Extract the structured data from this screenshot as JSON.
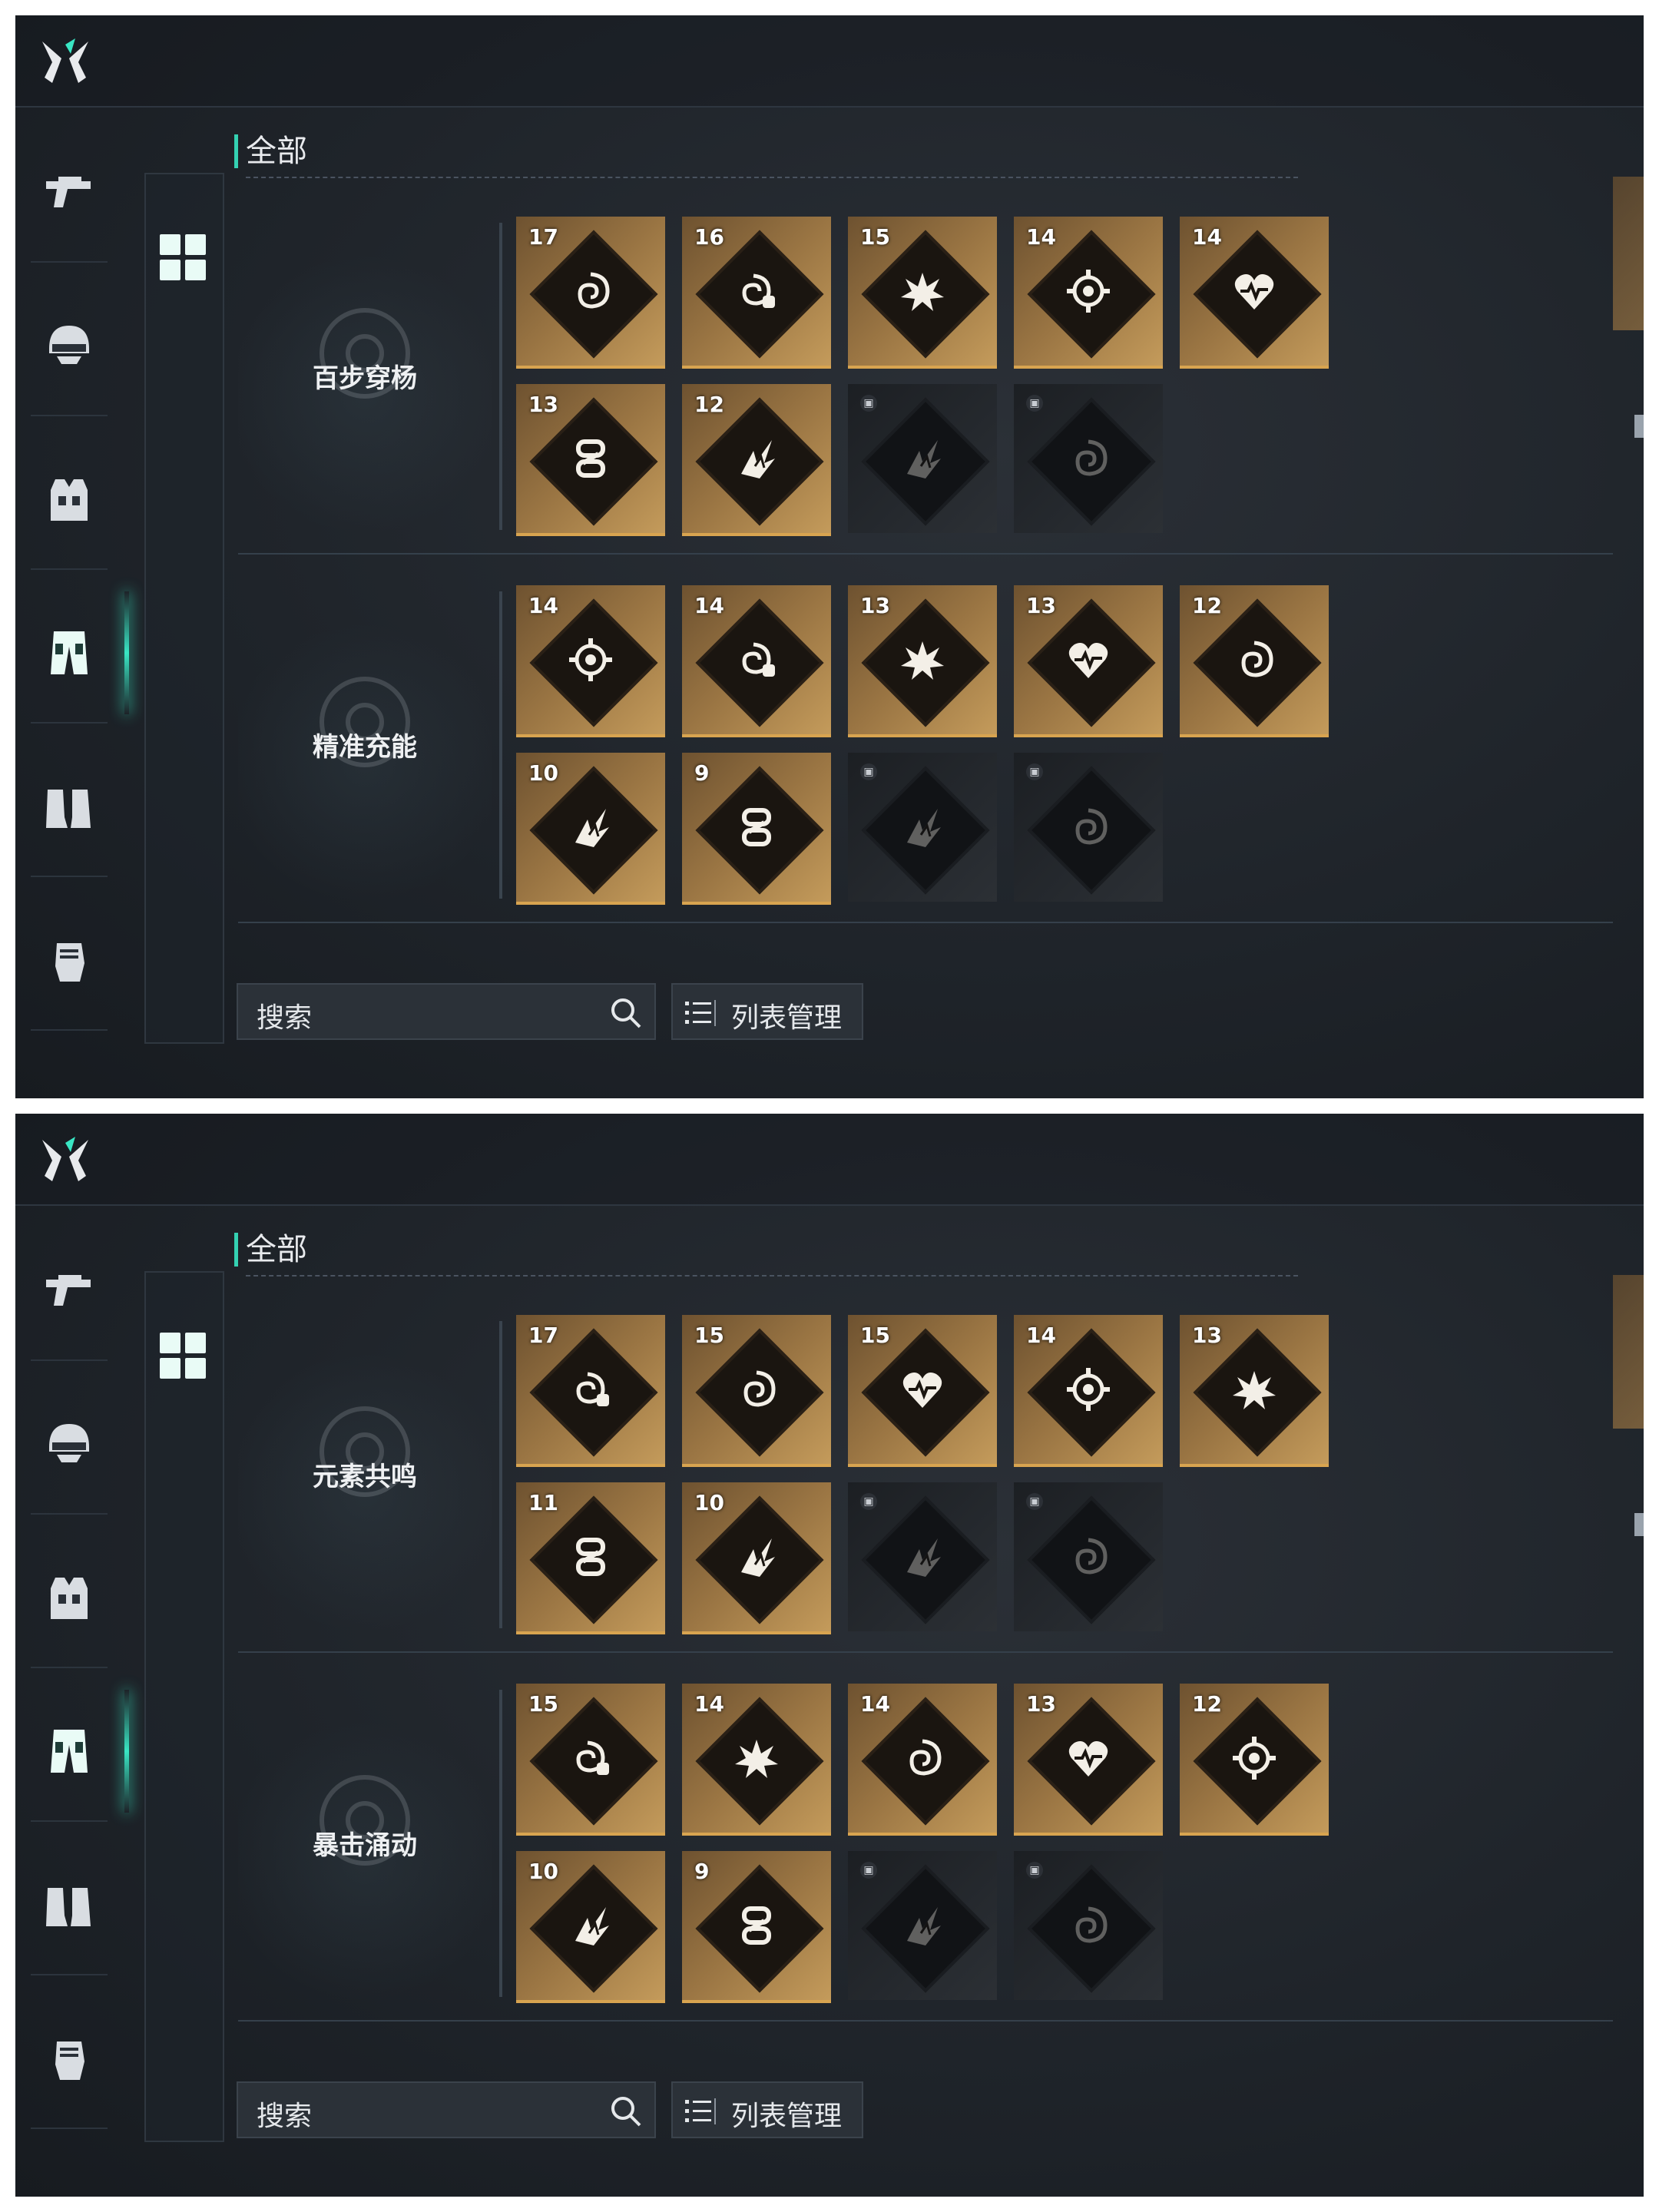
{
  "panels": [
    {
      "section_title": "全部",
      "search_placeholder": "搜索",
      "list_button": "列表管理",
      "rows": [
        {
          "label": "百步穿杨",
          "cards": [
            {
              "num": "17",
              "icon": "vortex"
            },
            {
              "num": "16",
              "icon": "vortex-link"
            },
            {
              "num": "15",
              "icon": "explosion"
            },
            {
              "num": "14",
              "icon": "crosshair"
            },
            {
              "num": "14",
              "icon": "heart-pulse"
            },
            {
              "num": "13",
              "icon": "chain"
            },
            {
              "num": "12",
              "icon": "arrow-burst"
            },
            {
              "num": "",
              "icon": "arrow-burst",
              "locked": true
            },
            {
              "num": "",
              "icon": "vortex",
              "locked": true
            }
          ]
        },
        {
          "label": "精准充能",
          "cards": [
            {
              "num": "14",
              "icon": "crosshair"
            },
            {
              "num": "14",
              "icon": "vortex-link"
            },
            {
              "num": "13",
              "icon": "explosion"
            },
            {
              "num": "13",
              "icon": "heart-pulse"
            },
            {
              "num": "12",
              "icon": "vortex"
            },
            {
              "num": "10",
              "icon": "arrow-burst"
            },
            {
              "num": "9",
              "icon": "chain"
            },
            {
              "num": "",
              "icon": "arrow-burst",
              "locked": true
            },
            {
              "num": "",
              "icon": "vortex",
              "locked": true
            }
          ]
        }
      ]
    },
    {
      "section_title": "全部",
      "search_placeholder": "搜索",
      "list_button": "列表管理",
      "rows": [
        {
          "label": "元素共鸣",
          "cards": [
            {
              "num": "17",
              "icon": "vortex-link"
            },
            {
              "num": "15",
              "icon": "vortex"
            },
            {
              "num": "15",
              "icon": "heart-pulse"
            },
            {
              "num": "14",
              "icon": "crosshair"
            },
            {
              "num": "13",
              "icon": "explosion"
            },
            {
              "num": "11",
              "icon": "chain"
            },
            {
              "num": "10",
              "icon": "arrow-burst"
            },
            {
              "num": "",
              "icon": "arrow-burst",
              "locked": true
            },
            {
              "num": "",
              "icon": "vortex",
              "locked": true
            }
          ]
        },
        {
          "label": "暴击涌动",
          "cards": [
            {
              "num": "15",
              "icon": "vortex-link"
            },
            {
              "num": "14",
              "icon": "explosion"
            },
            {
              "num": "14",
              "icon": "vortex"
            },
            {
              "num": "13",
              "icon": "heart-pulse"
            },
            {
              "num": "12",
              "icon": "crosshair"
            },
            {
              "num": "10",
              "icon": "arrow-burst"
            },
            {
              "num": "9",
              "icon": "chain"
            },
            {
              "num": "",
              "icon": "arrow-burst",
              "locked": true
            },
            {
              "num": "",
              "icon": "vortex",
              "locked": true
            }
          ]
        }
      ]
    }
  ],
  "sidebar_icons": [
    "pistol-icon",
    "helmet-icon",
    "vest-icon",
    "pants-icon",
    "boots-icon",
    "gloves-icon"
  ],
  "active_sidebar_index": 3,
  "colors": {
    "accent": "#39e6c4",
    "card_gold": "#c49b5b",
    "background": "#1f242a"
  }
}
